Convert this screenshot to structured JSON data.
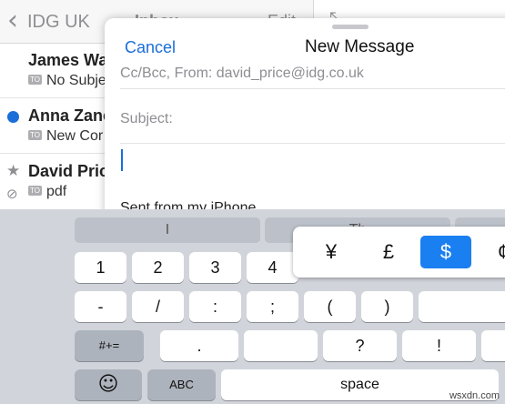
{
  "mail_list": {
    "back_label": "IDG UK",
    "title": "Inbox",
    "edit_label": "Edit",
    "messages": [
      {
        "sender": "James Wa",
        "badge": "TO",
        "subject": "No Subje"
      },
      {
        "sender": "Anna Zanc",
        "badge": "TO",
        "subject": "New Cor"
      },
      {
        "sender": "David Pric",
        "badge": "TO",
        "subject": "pdf"
      }
    ]
  },
  "compose": {
    "cancel_label": "Cancel",
    "title": "New Message",
    "from_field": "Cc/Bcc, From:  david_price@idg.co.uk",
    "subject_label": "Subject:",
    "signature": "Sent from my iPhone"
  },
  "keyboard": {
    "predictions": [
      "I",
      "Th",
      ""
    ],
    "row1": [
      "1",
      "2",
      "3",
      "4"
    ],
    "row2": [
      "-",
      "/",
      ":",
      ";",
      "(",
      ")"
    ],
    "row3": [
      "#+=",
      ".",
      "?",
      "!"
    ],
    "row4": {
      "emoji": "☺",
      "abc": "ABC",
      "space": "space"
    },
    "currency_popup": [
      "¥",
      "£",
      "$",
      "¢"
    ],
    "selected_currency": "$"
  },
  "watermark": "wsxdn.com"
}
